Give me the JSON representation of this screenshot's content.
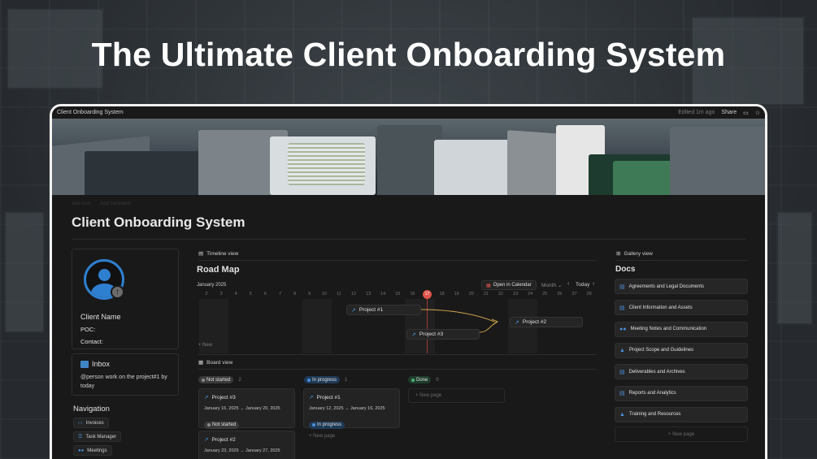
{
  "headline": "The Ultimate Client Onboarding System",
  "window": {
    "tab_title": "Client Onboarding System",
    "edited": "Edited 1m ago",
    "share": "Share"
  },
  "page": {
    "ghost_add_icon": "Add icon",
    "ghost_add_comment": "Add comment",
    "title": "Client Onboarding System"
  },
  "profile": {
    "name": "Client Name",
    "poc": "POC:",
    "contact": "Contact:"
  },
  "inbox": {
    "title": "Inbox",
    "text": "@person work on the project#1 by today"
  },
  "navigation": {
    "title": "Navigation",
    "items": [
      {
        "label": "Invoices",
        "icon": "invoice-icon"
      },
      {
        "label": "Task Manager",
        "icon": "list-icon"
      },
      {
        "label": "Meetings",
        "icon": "people-icon"
      }
    ]
  },
  "timeline": {
    "view_label": "Timeline view",
    "title": "Road Map",
    "month": "January 2025",
    "open_calendar": "Open in Calendar",
    "zoom": "Month",
    "today": "Today",
    "days": [
      "2",
      "3",
      "4",
      "5",
      "6",
      "7",
      "8",
      "9",
      "10",
      "11",
      "12",
      "13",
      "14",
      "15",
      "16",
      "17",
      "18",
      "19",
      "20",
      "21",
      "22",
      "23",
      "24",
      "25",
      "26",
      "27",
      "28"
    ],
    "today_day": "17",
    "bars": [
      {
        "label": "Project #1"
      },
      {
        "label": "Project #3"
      },
      {
        "label": "Project #2"
      }
    ],
    "new_label": "New"
  },
  "board": {
    "view_label": "Board view",
    "columns": [
      {
        "status": "Not started",
        "count": "2",
        "color": "#6b6b6b",
        "bg": "#3a3a3a"
      },
      {
        "status": "In progress",
        "count": "1",
        "color": "#4a90d9",
        "bg": "#1f3a57"
      },
      {
        "status": "Done",
        "count": "0",
        "color": "#4caf72",
        "bg": "#1f3d2b"
      }
    ],
    "cards": [
      {
        "title": "Project #3",
        "dates": "January 16, 2025 → January 20, 2025",
        "status": "Not started"
      },
      {
        "title": "Project #2",
        "dates": "January 23, 2025 → January 27, 2025"
      },
      {
        "title": "Project #1",
        "dates": "January 12, 2025 → January 16, 2025",
        "status": "In progress"
      }
    ],
    "new_page": "New page"
  },
  "gallery": {
    "view_label": "Gallery view",
    "title": "Docs",
    "docs": [
      "Agreements and Legal Documents",
      "Client Information and Assets",
      "Meeting Notes and Communication",
      "Project Scope and Guidelines",
      "Deliverables and Archives",
      "Reports and Analytics",
      "Training and Resources"
    ],
    "new_page": "New page"
  },
  "colors": {
    "accent_blue": "#2f7fd0",
    "today_red": "#e0534b",
    "page_bg": "#191919"
  }
}
